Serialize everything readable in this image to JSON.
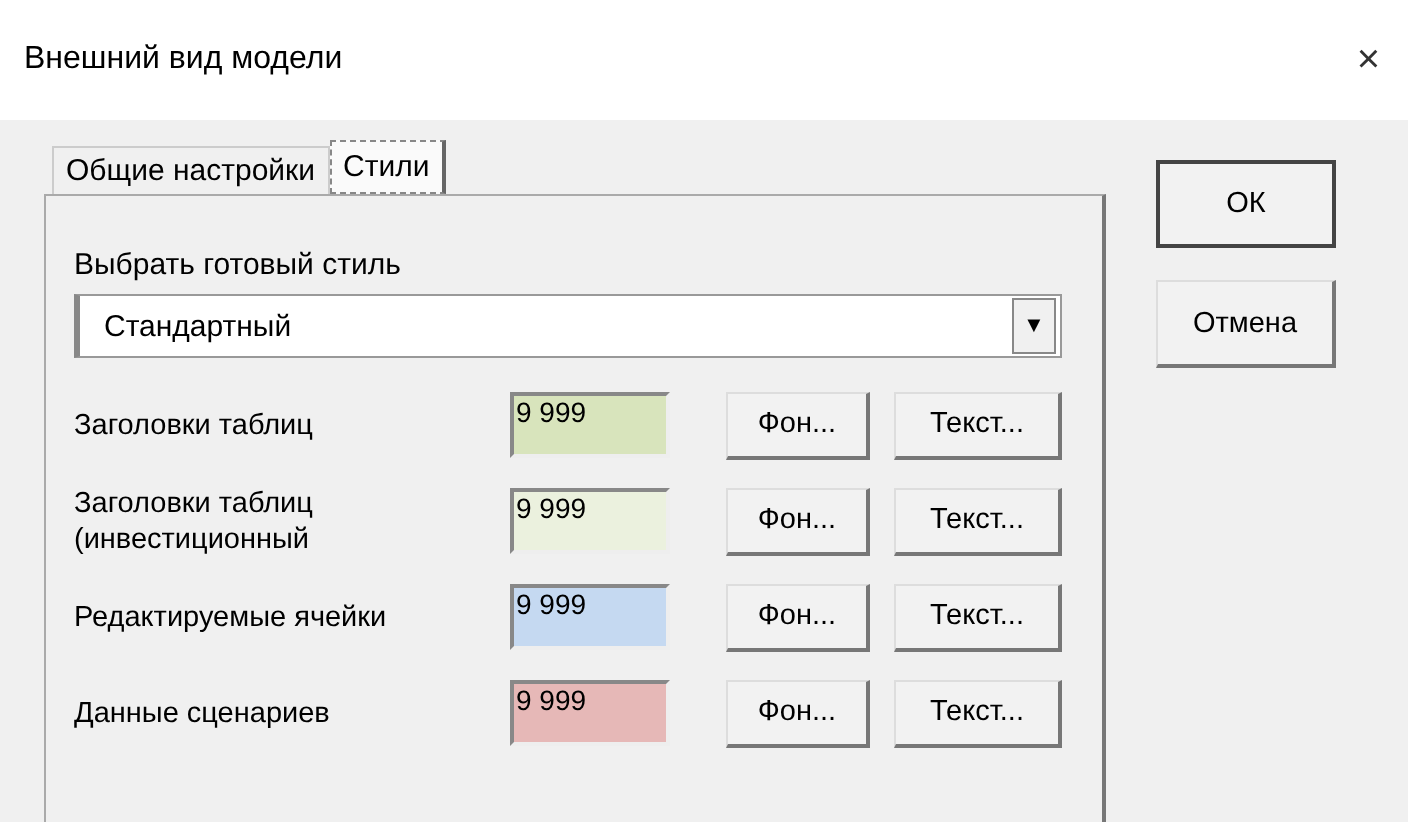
{
  "window": {
    "title": "Внешний вид модели",
    "close": "×"
  },
  "tabs": [
    {
      "label": "Общие настройки",
      "selected": false
    },
    {
      "label": "Стили",
      "selected": true
    }
  ],
  "style_picker": {
    "label": "Выбрать готовый стиль",
    "value": "Стандартный",
    "arrow": "▼"
  },
  "styles": [
    {
      "name": "Заголовки таблиц",
      "sample": "9 999",
      "color": "#d8e4bc",
      "bg_button": "Фон...",
      "text_button": "Текст..."
    },
    {
      "name": "Заголовки таблиц\n(инвестиционный",
      "sample": "9 999",
      "color": "#ebf1de",
      "bg_button": "Фон...",
      "text_button": "Текст..."
    },
    {
      "name": "Редактируемые ячейки",
      "sample": "9 999",
      "color": "#c5d9f1",
      "bg_button": "Фон...",
      "text_button": "Текст..."
    },
    {
      "name": "Данные сценариев",
      "sample": "9 999",
      "color": "#e6b8b7",
      "bg_button": "Фон...",
      "text_button": "Текст..."
    }
  ],
  "buttons": [
    {
      "label": "ОК",
      "default": true
    },
    {
      "label": "Отмена",
      "default": false
    }
  ]
}
